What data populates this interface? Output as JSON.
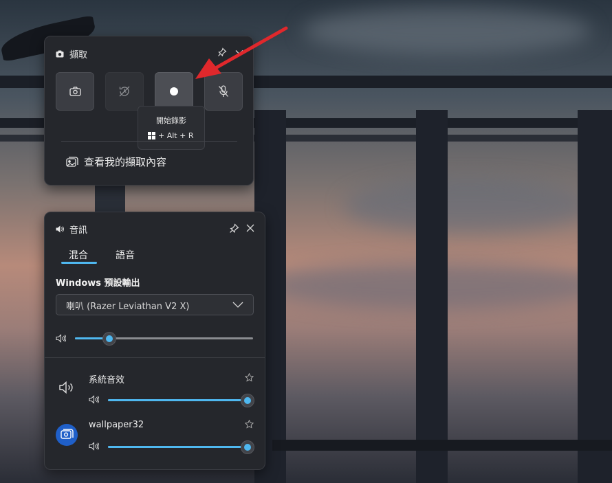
{
  "capture": {
    "title": "擷取",
    "tooltip_title": "開始錄影",
    "tooltip_shortcut": "+ Alt + R",
    "view_captures": "查看我的擷取內容"
  },
  "audio": {
    "title": "音訊",
    "tabs": [
      "混合",
      "語音"
    ],
    "output_heading": "Windows 預設輸出",
    "device": "喇叭 (Razer Leviathan V2 X)",
    "master_volume": 0.19,
    "apps": [
      {
        "name": "系統音效",
        "volume": 1.0
      },
      {
        "name": "wallpaper32",
        "volume": 1.0
      }
    ]
  },
  "colors": {
    "accent": "#4fb8f0",
    "arrow": "#e0282c"
  }
}
